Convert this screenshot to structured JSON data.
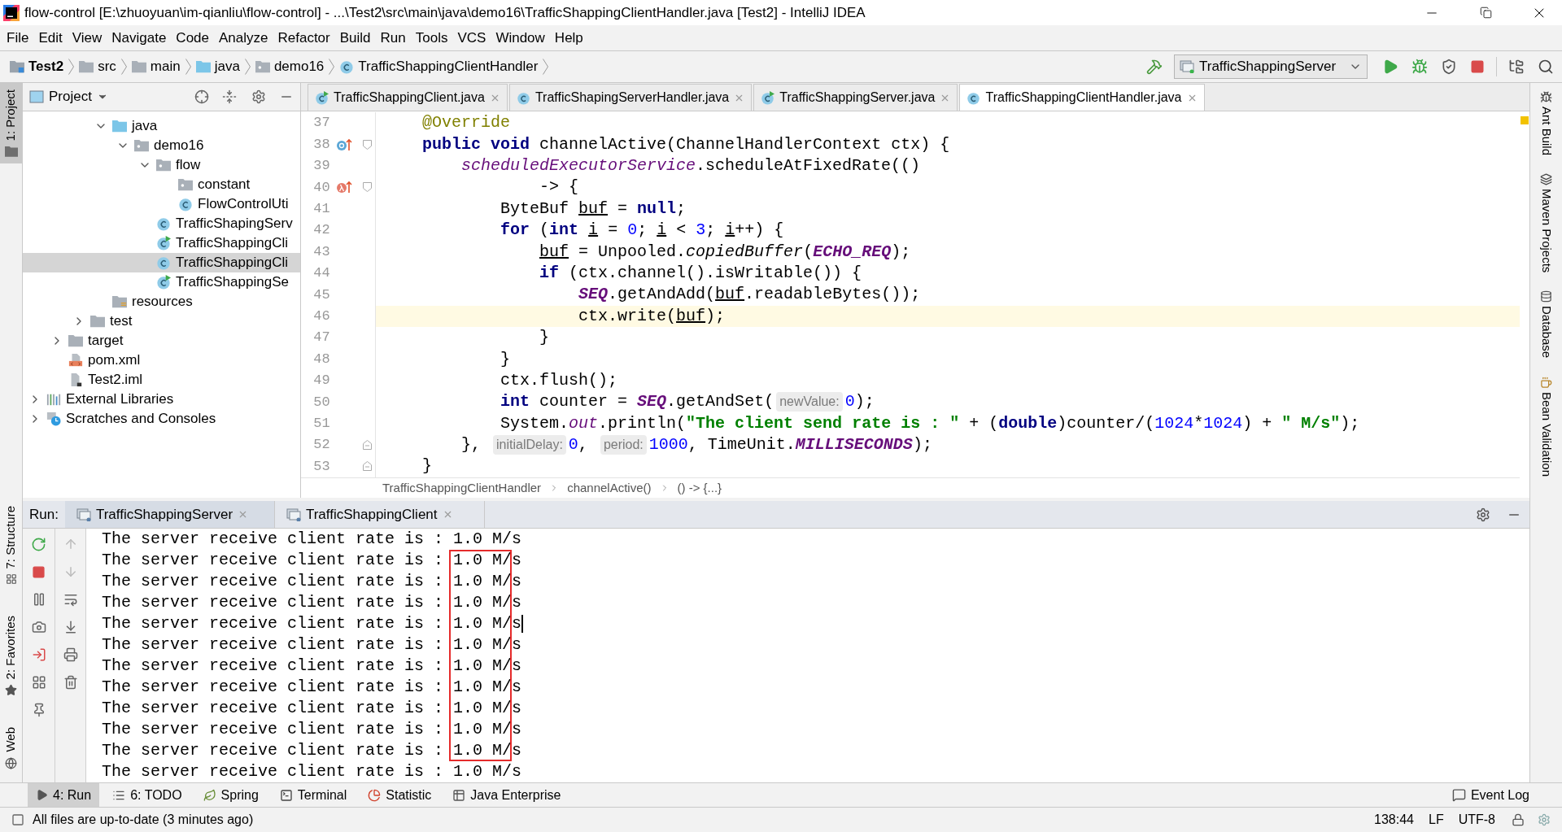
{
  "window": {
    "title": "flow-control [E:\\zhuoyuan\\im-qianliu\\flow-control] - ...\\Test2\\src\\main\\java\\demo16\\TrafficShappingClientHandler.java [Test2] - IntelliJ IDEA"
  },
  "menu": [
    "File",
    "Edit",
    "View",
    "Navigate",
    "Code",
    "Analyze",
    "Refactor",
    "Build",
    "Run",
    "Tools",
    "VCS",
    "Window",
    "Help"
  ],
  "navigation_bar": {
    "crumbs": [
      {
        "label": "Test2",
        "kind": "module"
      },
      {
        "label": "src",
        "kind": "folder"
      },
      {
        "label": "main",
        "kind": "folder"
      },
      {
        "label": "java",
        "kind": "source"
      },
      {
        "label": "demo16",
        "kind": "package"
      },
      {
        "label": "TrafficShappingClientHandler",
        "kind": "class"
      }
    ],
    "run_configuration": "TrafficShappingServer"
  },
  "left_stripe": [
    {
      "label": "1: Project",
      "kind": "project",
      "selected": true
    },
    {
      "label": "7: Structure",
      "kind": "structure",
      "selected": false
    },
    {
      "label": "2: Favorites",
      "kind": "favorites",
      "selected": false
    },
    {
      "label": "Web",
      "kind": "web",
      "selected": false
    }
  ],
  "project_panel": {
    "title": "Project",
    "tree": [
      {
        "children": [
          {
            "children": [
              {
                "children": [
                  {
                    "label": "java",
                    "kind": "source",
                    "expanded": true,
                    "selected": false,
                    "children": [
                      {
                        "label": "demo16",
                        "kind": "package",
                        "expanded": true,
                        "selected": false,
                        "children": [
                          {
                            "label": "flow",
                            "kind": "package",
                            "expanded": true,
                            "selected": false,
                            "children": [
                              {
                                "label": "constant",
                                "kind": "package",
                                "selected": false
                              },
                              {
                                "label": "FlowControlUti",
                                "kind": "class",
                                "selected": false
                              }
                            ]
                          },
                          {
                            "label": "TrafficShapingServ",
                            "kind": "class",
                            "selected": false
                          },
                          {
                            "label": "TrafficShappingCli",
                            "kind": "runnable",
                            "selected": false
                          },
                          {
                            "label": "TrafficShappingCli",
                            "kind": "class",
                            "selected": true
                          },
                          {
                            "label": "TrafficShappingSe",
                            "kind": "runnable",
                            "selected": false
                          }
                        ]
                      }
                    ]
                  },
                  {
                    "label": "resources",
                    "kind": "resources",
                    "selected": false
                  }
                ]
              },
              {
                "label": "test",
                "kind": "folder",
                "expanded": false,
                "selected": false
              }
            ]
          },
          {
            "label": "target",
            "kind": "folder",
            "expanded": false,
            "selected": false
          },
          {
            "label": "pom.xml",
            "kind": "maven",
            "selected": false
          },
          {
            "label": "Test2.iml",
            "kind": "iml",
            "selected": false
          }
        ]
      },
      {
        "label": "External Libraries",
        "kind": "libraries",
        "expanded": false,
        "selected": false
      },
      {
        "label": "Scratches and Consoles",
        "kind": "scratches",
        "expanded": false,
        "selected": false
      }
    ]
  },
  "editor_tabs": [
    {
      "label": "TrafficShappingClient.java",
      "kind": "runnable",
      "selected": false
    },
    {
      "label": "TrafficShapingServerHandler.java",
      "kind": "class",
      "selected": false
    },
    {
      "label": "TrafficShappingServer.java",
      "kind": "runnable",
      "selected": false
    },
    {
      "label": "TrafficShappingClientHandler.java",
      "kind": "class",
      "selected": true
    }
  ],
  "editor": {
    "lines": [
      {
        "number": "37",
        "current": false,
        "tokens": [
          {
            "kind": "annotation",
            "text": "    @Override"
          }
        ]
      },
      {
        "number": "38",
        "current": false,
        "marker": {
          "kind": "override"
        },
        "fold": {
          "kind": "open"
        },
        "tokens": [
          {
            "kind": "keyword",
            "text": "    public void"
          },
          {
            "kind": "plain",
            "text": " channelActive(ChannelHandlerContext ctx) {"
          }
        ]
      },
      {
        "number": "39",
        "current": false,
        "tokens": [
          {
            "kind": "field",
            "text": "        scheduledExecutorService"
          },
          {
            "kind": "plain",
            "text": ".scheduleAtFixedRate(()"
          }
        ]
      },
      {
        "number": "40",
        "current": false,
        "marker": {
          "kind": "lambda"
        },
        "fold": {
          "kind": "open"
        },
        "tokens": [
          {
            "kind": "plain",
            "text": "                -> {"
          }
        ]
      },
      {
        "number": "41",
        "current": false,
        "tokens": [
          {
            "kind": "plain",
            "text": "            ByteBuf "
          },
          {
            "kind": "underline",
            "text": "buf"
          },
          {
            "kind": "plain",
            "text": " = "
          },
          {
            "kind": "keyword",
            "text": "null"
          },
          {
            "kind": "plain",
            "text": ";"
          }
        ]
      },
      {
        "number": "42",
        "current": false,
        "tokens": [
          {
            "kind": "keyword",
            "text": "            for"
          },
          {
            "kind": "plain",
            "text": " ("
          },
          {
            "kind": "keyword",
            "text": "int"
          },
          {
            "kind": "underline",
            "text": " i"
          },
          {
            "kind": "plain",
            "text": " = "
          },
          {
            "kind": "number",
            "text": "0"
          },
          {
            "kind": "plain",
            "text": "; "
          },
          {
            "kind": "underline",
            "text": "i"
          },
          {
            "kind": "plain",
            "text": " < "
          },
          {
            "kind": "number",
            "text": "3"
          },
          {
            "kind": "plain",
            "text": "; "
          },
          {
            "kind": "underline",
            "text": "i"
          },
          {
            "kind": "plain",
            "text": "++) {"
          }
        ]
      },
      {
        "number": "43",
        "current": false,
        "tokens": [
          {
            "kind": "underline",
            "text": "                buf"
          },
          {
            "kind": "plain",
            "text": " = Unpooled."
          },
          {
            "kind": "italic",
            "text": "copiedBuffer"
          },
          {
            "kind": "plain",
            "text": "("
          },
          {
            "kind": "static",
            "text": "ECHO_REQ"
          },
          {
            "kind": "plain",
            "text": ");"
          }
        ]
      },
      {
        "number": "44",
        "current": false,
        "tokens": [
          {
            "kind": "keyword",
            "text": "                if"
          },
          {
            "kind": "plain",
            "text": " (ctx.channel().isWritable()) {"
          }
        ]
      },
      {
        "number": "45",
        "current": false,
        "tokens": [
          {
            "kind": "static",
            "text": "                    SEQ"
          },
          {
            "kind": "plain",
            "text": ".getAndAdd("
          },
          {
            "kind": "underline",
            "text": "buf"
          },
          {
            "kind": "plain",
            "text": ".readableBytes());"
          }
        ]
      },
      {
        "number": "46",
        "current": true,
        "tokens": [
          {
            "kind": "plain",
            "text": "                    ctx.write("
          },
          {
            "kind": "underline",
            "text": "buf"
          },
          {
            "kind": "plain",
            "text": ");"
          }
        ]
      },
      {
        "number": "47",
        "current": false,
        "tokens": [
          {
            "kind": "plain",
            "text": "                }"
          }
        ]
      },
      {
        "number": "48",
        "current": false,
        "tokens": [
          {
            "kind": "plain",
            "text": "            }"
          }
        ]
      },
      {
        "number": "49",
        "current": false,
        "tokens": [
          {
            "kind": "plain",
            "text": "            ctx.flush();"
          }
        ]
      },
      {
        "number": "50",
        "current": false,
        "tokens": [
          {
            "kind": "keyword",
            "text": "            int"
          },
          {
            "kind": "plain",
            "text": " counter = "
          },
          {
            "kind": "static",
            "text": "SEQ"
          },
          {
            "kind": "plain",
            "text": ".getAndSet("
          },
          {
            "kind": "hint",
            "text": "newValue:"
          },
          {
            "kind": "number",
            "text": "0"
          },
          {
            "kind": "plain",
            "text": ");"
          }
        ]
      },
      {
        "number": "51",
        "current": false,
        "tokens": [
          {
            "kind": "plain",
            "text": "            System."
          },
          {
            "kind": "field",
            "text": "out"
          },
          {
            "kind": "plain",
            "text": ".println("
          },
          {
            "kind": "string",
            "text": "\"The client send rate is : \""
          },
          {
            "kind": "plain",
            "text": " + ("
          },
          {
            "kind": "keyword",
            "text": "double"
          },
          {
            "kind": "plain",
            "text": ")counter/("
          },
          {
            "kind": "number",
            "text": "1024"
          },
          {
            "kind": "plain",
            "text": "*"
          },
          {
            "kind": "number",
            "text": "1024"
          },
          {
            "kind": "plain",
            "text": ") + "
          },
          {
            "kind": "string",
            "text": "\" M/s\""
          },
          {
            "kind": "plain",
            "text": ");"
          }
        ]
      },
      {
        "number": "52",
        "current": false,
        "fold": {
          "kind": "close"
        },
        "tokens": [
          {
            "kind": "plain",
            "text": "        }, "
          },
          {
            "kind": "hint",
            "text": "initialDelay:"
          },
          {
            "kind": "number",
            "text": "0"
          },
          {
            "kind": "plain",
            "text": ", "
          },
          {
            "kind": "hint",
            "text": "period:"
          },
          {
            "kind": "number",
            "text": "1000"
          },
          {
            "kind": "plain",
            "text": ", TimeUnit."
          },
          {
            "kind": "static",
            "text": "MILLISECONDS"
          },
          {
            "kind": "plain",
            "text": ");"
          }
        ]
      },
      {
        "number": "53",
        "current": false,
        "fold": {
          "kind": "close"
        },
        "tokens": [
          {
            "kind": "plain",
            "text": "    }"
          }
        ]
      }
    ],
    "breadcrumb": [
      "TrafficShappingClientHandler",
      "channelActive()",
      "() -> {...}"
    ]
  },
  "run_panel": {
    "label": "Run:",
    "tabs": [
      {
        "label": "TrafficShappingServer",
        "selected": true
      },
      {
        "label": "TrafficShappingClient",
        "selected": false
      }
    ],
    "console_lines": [
      {
        "text": "The server receive client rate is : 1.0 M/s",
        "marked": false,
        "caret": false
      },
      {
        "text": "The server receive client rate is : 1.0 M/s",
        "marked": true,
        "caret": false
      },
      {
        "text": "The server receive client rate is : 1.0 M/s",
        "marked": true,
        "caret": false
      },
      {
        "text": "The server receive client rate is : 1.0 M/s",
        "marked": true,
        "caret": false
      },
      {
        "text": "The server receive client rate is : 1.0 M/s",
        "marked": true,
        "caret": true
      },
      {
        "text": "The server receive client rate is : 1.0 M/s",
        "marked": true,
        "caret": false
      },
      {
        "text": "The server receive client rate is : 1.0 M/s",
        "marked": true,
        "caret": false
      },
      {
        "text": "The server receive client rate is : 1.0 M/s",
        "marked": true,
        "caret": false
      },
      {
        "text": "The server receive client rate is : 1.0 M/s",
        "marked": true,
        "caret": false
      },
      {
        "text": "The server receive client rate is : 1.0 M/s",
        "marked": true,
        "caret": false
      },
      {
        "text": "The server receive client rate is : 1.0 M/s",
        "marked": true,
        "caret": false
      },
      {
        "text": "The server receive client rate is : 1.0 M/s",
        "marked": false,
        "caret": false
      }
    ]
  },
  "right_stripe": [
    {
      "label": "Ant Build",
      "kind": "ant"
    },
    {
      "label": "Maven Projects",
      "kind": "maven"
    },
    {
      "label": "Database",
      "kind": "database"
    },
    {
      "label": "Bean Validation",
      "kind": "bean"
    }
  ],
  "tool_windows": [
    {
      "label": "4: Run",
      "kind": "run",
      "selected": true
    },
    {
      "label": "6: TODO",
      "kind": "todo",
      "selected": false
    },
    {
      "label": "Spring",
      "kind": "spring",
      "selected": false
    },
    {
      "label": "Terminal",
      "kind": "terminal",
      "selected": false
    },
    {
      "label": "Statistic",
      "kind": "statistic",
      "selected": false
    },
    {
      "label": "Java Enterprise",
      "kind": "enterprise",
      "selected": false
    }
  ],
  "event_log": "Event Log",
  "status_bar": {
    "message": "All files are up-to-date (3 minutes ago)",
    "position": "138:44",
    "line_separator": "LF",
    "encoding": "UTF-8"
  }
}
